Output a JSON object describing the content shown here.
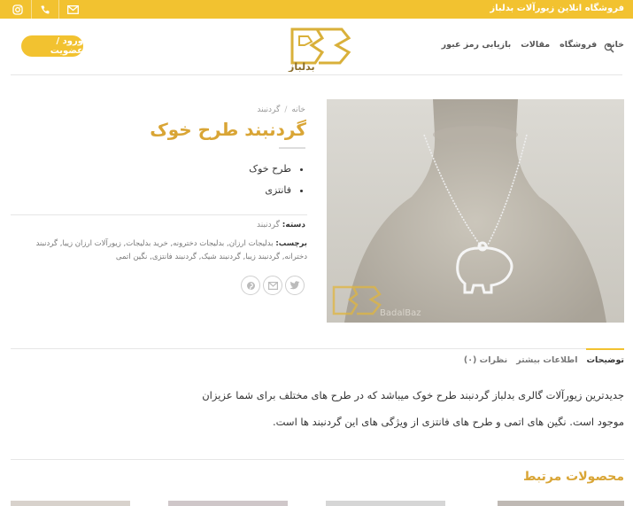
{
  "topbar": {
    "site_title": "فروشگاه انلاین زیورآلات بدلباز",
    "icons": [
      "instagram-icon",
      "phone-icon",
      "mail-icon"
    ]
  },
  "header": {
    "nav": [
      "خانه",
      "فروشگاه",
      "مقالات",
      "بازیابی رمز عبور"
    ],
    "login_label": "ورود / عضویت",
    "logo_text": "بدلباز"
  },
  "product": {
    "breadcrumb_home": "خانه",
    "breadcrumb_sep": "/",
    "breadcrumb_category": "گردنبند",
    "title": "گردنبند طرح خوک",
    "features": [
      "طرح خوک",
      "فانتزی"
    ],
    "category_label": "دسته:",
    "category_value": "گردنبند",
    "tags_label": "برچسب:",
    "tags_value": "بدلیجات ارزان, بدلیجات دخترونه, خرید بدلیجات, زیورآلات ارزان زیبا, گردنبند دخترانه, گردنبند زیبا, گردنبند شیک, گردنبند فانتزی, نگین اتمی",
    "watermark_text": "BadalBaz"
  },
  "tabs": {
    "description": "توضیحات",
    "more_info": "اطلاعات بیشتر",
    "reviews": "نظرات (۰)"
  },
  "description": {
    "line1": "جدیدترین زیورآلات گالری بدلباز گردنبند طرح خوک میباشد که در طرح های مختلف برای شما عزیزان",
    "line2": "موجود است. نگین های اتمی و طرح های فانتزی از ویژگی های این گردنبند ها است."
  },
  "related": {
    "title": "محصولات مرتبط"
  },
  "colors": {
    "accent": "#f2c230",
    "title_gold": "#d9a535"
  }
}
